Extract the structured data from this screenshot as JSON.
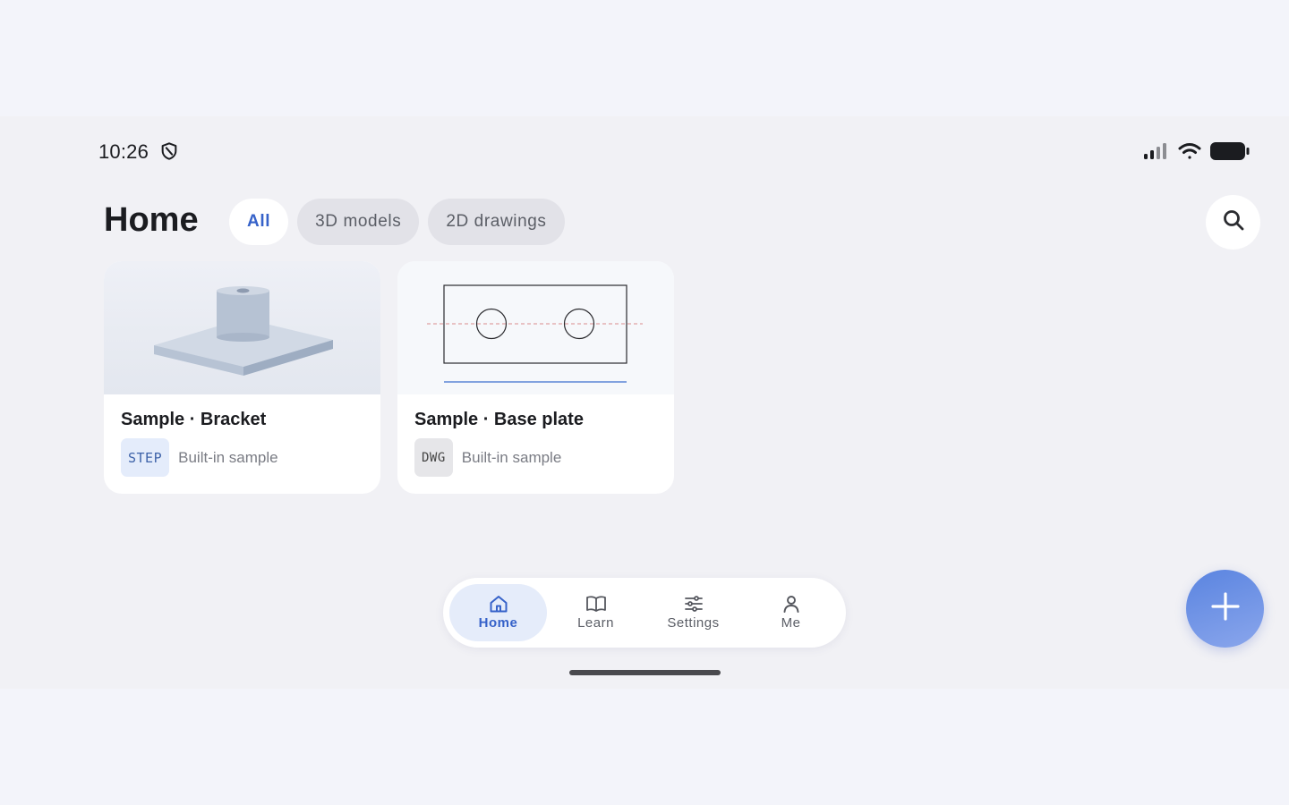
{
  "status_bar": {
    "time": "10:26",
    "left_icon": "shield-icon",
    "right_icons": [
      "signal-icon",
      "wifi-icon",
      "battery-icon"
    ]
  },
  "header": {
    "title": "Home",
    "filters": [
      {
        "label": "All",
        "active": true
      },
      {
        "label": "3D models",
        "active": false
      },
      {
        "label": "2D drawings",
        "active": false
      }
    ],
    "search_icon": "search-icon"
  },
  "cards": [
    {
      "title": "Sample · Bracket",
      "format": "STEP",
      "subtitle": "Built-in sample",
      "thumbnail": "3d-bracket-render"
    },
    {
      "title": "Sample · Base plate",
      "format": "DWG",
      "subtitle": "Built-in sample",
      "thumbnail": "2d-base-plate-drawing"
    }
  ],
  "bottom_nav": {
    "items": [
      {
        "label": "Home",
        "icon": "home-icon",
        "active": true
      },
      {
        "label": "Learn",
        "icon": "book-icon",
        "active": false
      },
      {
        "label": "Settings",
        "icon": "sliders-icon",
        "active": false
      },
      {
        "label": "Me",
        "icon": "person-icon",
        "active": false
      }
    ]
  },
  "fab": {
    "icon": "plus-icon"
  },
  "colors": {
    "accent": "#3662c9",
    "background": "#f1f1f5",
    "card": "#ffffff",
    "fab_gradient": [
      "#5a84e0",
      "#8aa6ec"
    ]
  }
}
